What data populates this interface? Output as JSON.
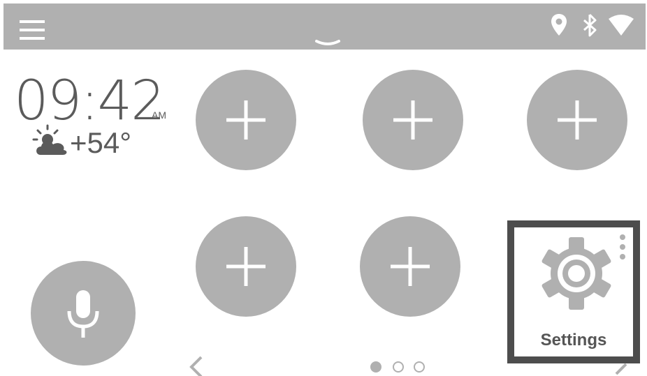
{
  "status_bar": {
    "icons": [
      "menu-icon",
      "pull-down-handle-icon",
      "location-pin-icon",
      "bluetooth-icon",
      "wifi-icon"
    ]
  },
  "clock": {
    "time": "09:42",
    "ampm": "AM",
    "temperature": "+54°",
    "weather_icon": "partly-sunny-cloud-icon"
  },
  "shortcuts": [
    {
      "icon": "plus-icon"
    },
    {
      "icon": "plus-icon"
    },
    {
      "icon": "plus-icon"
    },
    {
      "icon": "plus-icon"
    },
    {
      "icon": "plus-icon"
    }
  ],
  "voice": {
    "icon": "microphone-icon"
  },
  "settings_tile": {
    "label": "Settings",
    "icon": "gear-icon",
    "menu_icon": "more-vertical-icon"
  },
  "pager": {
    "total_pages": 3,
    "current_page": 1
  },
  "colors": {
    "bar": "#b0b0b0",
    "tile": "#b0b0b0",
    "text": "#5b5b5b",
    "focus_border": "#4d4d4d"
  }
}
